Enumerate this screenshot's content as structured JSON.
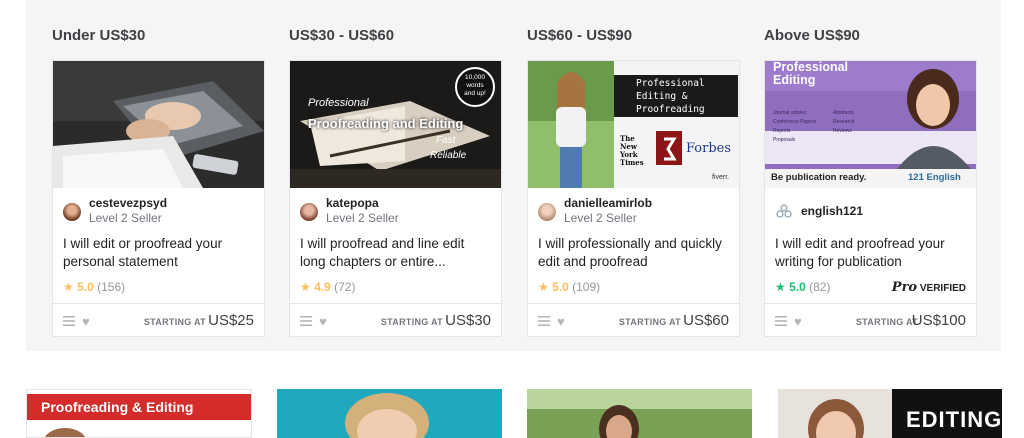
{
  "columns": [
    {
      "title": "Under US$30",
      "seller_name": "cestevezpsyd",
      "seller_level": "Level 2 Seller",
      "gig_title": "I will edit or proofread your personal statement",
      "rating_score": "5.0",
      "rating_count": "(156)",
      "starting_label": "STARTING AT",
      "price": "US$25"
    },
    {
      "title": "US$30 - US$60",
      "seller_name": "katepopa",
      "seller_level": "Level 2 Seller",
      "gig_title": "I will proofread and line edit long chapters or entire...",
      "rating_score": "4.9",
      "rating_count": "(72)",
      "starting_label": "STARTING AT",
      "price": "US$30",
      "thumb_text": {
        "badge_line1": "10,000",
        "badge_line2": "words",
        "badge_line3": "and up!",
        "line1": "Professional",
        "line2": "Proofreading and Editing",
        "line3": "Fast",
        "line4": "Reliable"
      }
    },
    {
      "title": "US$60 - US$90",
      "seller_name": "danielleamirlob",
      "seller_level": "Level 2 Seller",
      "gig_title": "I will professionally and quickly edit and proofread",
      "rating_score": "5.0",
      "rating_count": "(109)",
      "starting_label": "STARTING AT",
      "price": "US$60",
      "thumb_text": {
        "line1": "Professional",
        "line2": "Editing &",
        "line3": "Proofreading",
        "nyt": "The New York Times",
        "forbes": "Forbes",
        "fiverr": "fiverr."
      }
    },
    {
      "title": "Above US$90",
      "seller_name": "english121",
      "gig_title": "I will edit and proofread your writing for publication",
      "rating_score": "5.0",
      "rating_count": "(82)",
      "pro_label": "VERIFIED",
      "pro_logo": "Pro",
      "starting_label": "STARTING AT",
      "price": "US$100",
      "thumb_text": {
        "heading": "Professional Editing",
        "list": [
          "Journal articles",
          "Abstracts",
          "Conference Papers",
          "Research",
          "Reports",
          "Reviews",
          "Proposals"
        ],
        "footer": "Be publication ready.",
        "brand": "121 English"
      }
    }
  ],
  "bottom_row": {
    "thumb1_text": "Proofreading & Editing",
    "thumb4_text": "EDITING"
  },
  "colors": {
    "star_yellow": "#ffbe5b",
    "star_teal": "#1dbf73",
    "band_bg": "#f5f5f5"
  }
}
